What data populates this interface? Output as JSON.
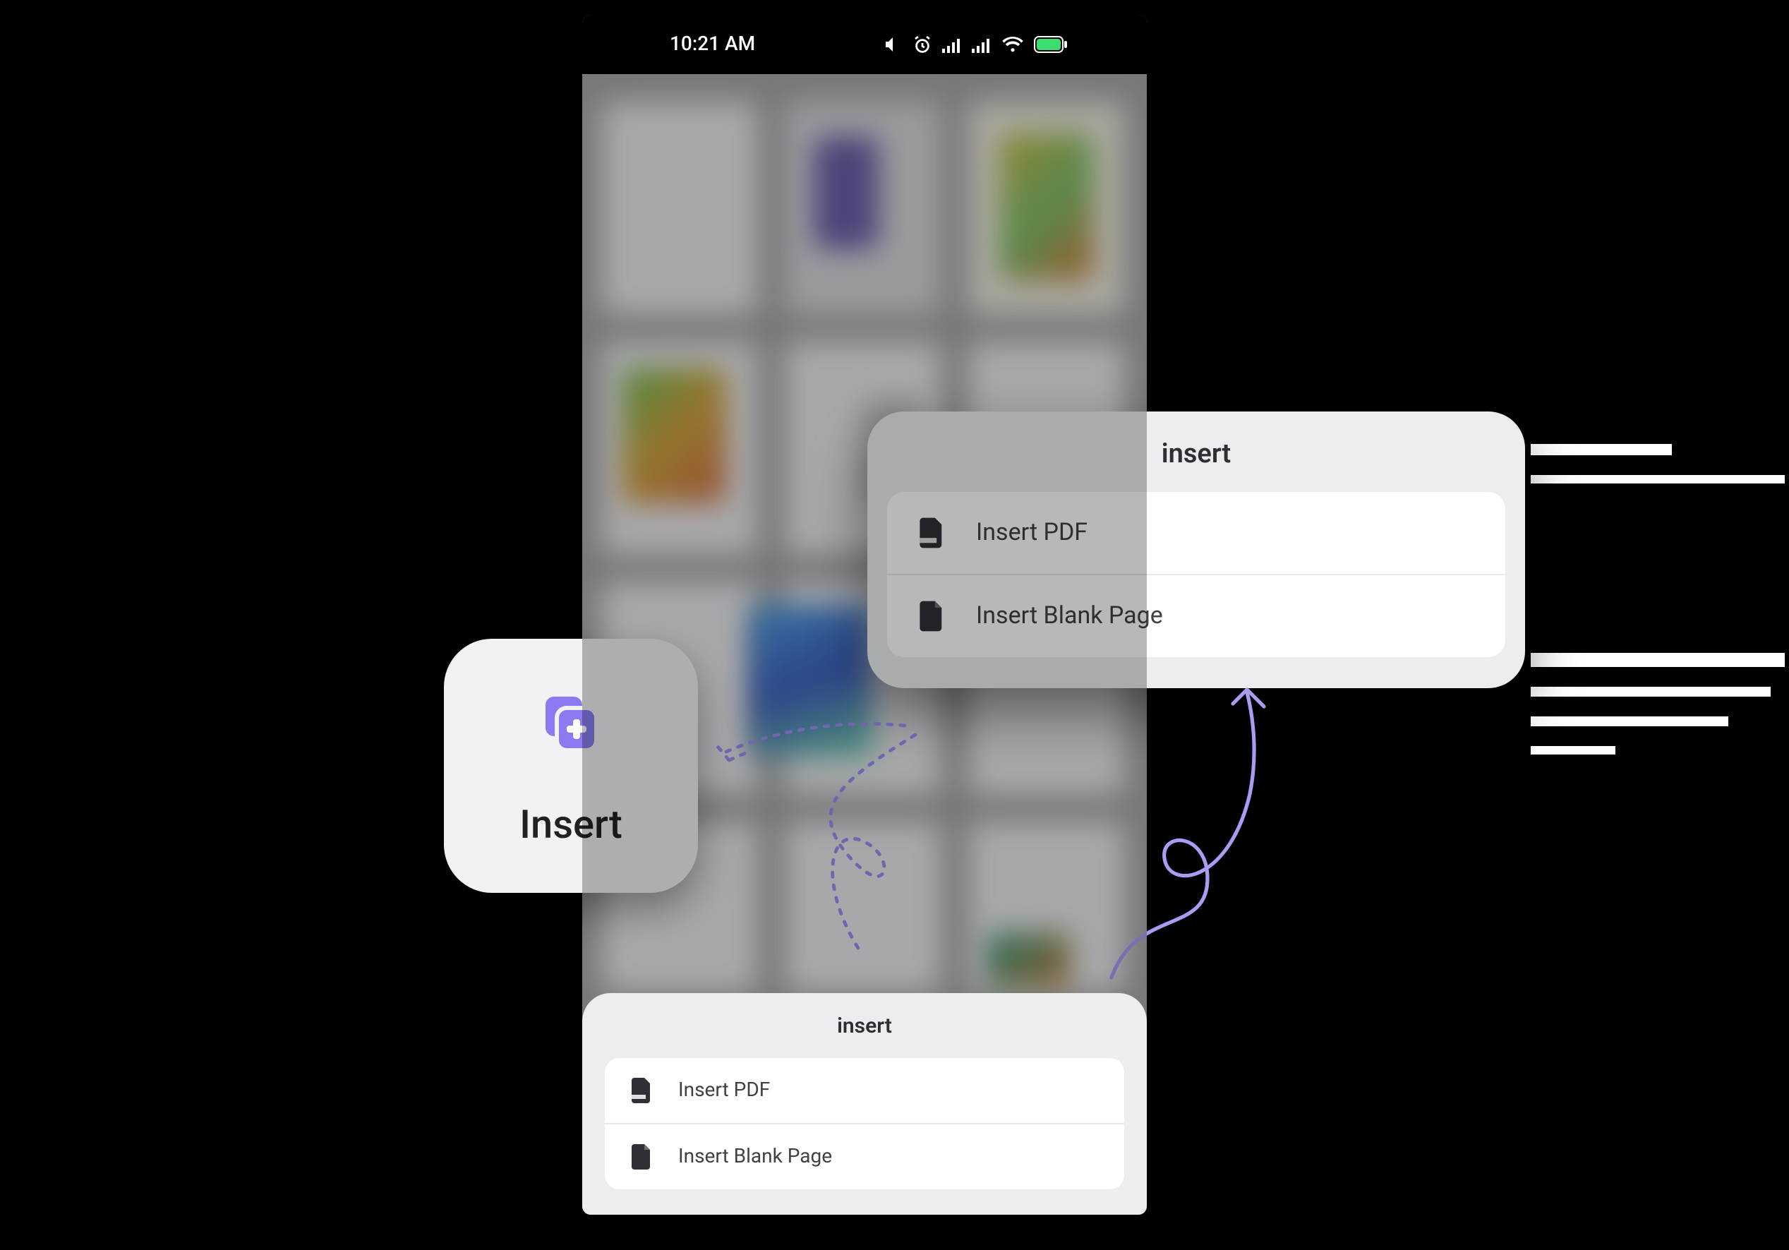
{
  "status": {
    "time": "10:21 AM"
  },
  "insert_button": {
    "label": "Insert"
  },
  "sheet": {
    "title": "insert",
    "items": [
      {
        "label": "Insert PDF",
        "icon": "pdf"
      },
      {
        "label": "Insert Blank Page",
        "icon": "blank"
      }
    ]
  },
  "popup": {
    "title": "insert",
    "items": [
      {
        "label": "Insert PDF",
        "icon": "pdf"
      },
      {
        "label": "Insert Blank Page",
        "icon": "blank"
      }
    ]
  },
  "colors": {
    "accent": "#8a7cf0",
    "sheet_bg": "#ecedef"
  }
}
